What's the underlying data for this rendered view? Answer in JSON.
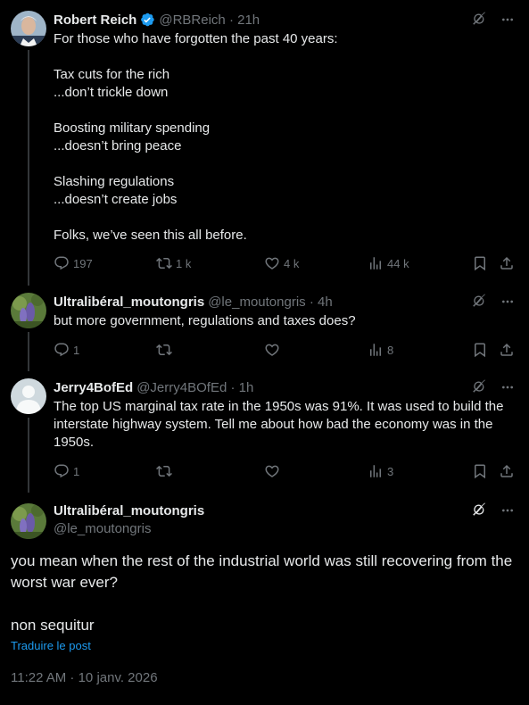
{
  "colors": {
    "accent": "#1d9bf0",
    "muted": "#71767b",
    "text": "#e7e9ea",
    "background": "#000000"
  },
  "tweets": [
    {
      "name": "Robert Reich",
      "handle": "@RBReich",
      "time": "21h",
      "verified": true,
      "text": "For those who have forgotten the past 40 years:\n\nTax cuts for the rich\n...don’t trickle down\n\nBoosting military spending\n...doesn’t bring peace\n\nSlashing regulations\n...doesn’t create jobs\n\nFolks, we’ve seen this all before.",
      "replies": "197",
      "retweets": "1 k",
      "likes": "4 k",
      "views": "44 k"
    },
    {
      "name": "Ultralibéral_moutongris",
      "handle": "@le_moutongris",
      "time": "4h",
      "text": "but more government, regulations and taxes does?",
      "replies": "1",
      "retweets": "",
      "likes": "",
      "views": "8"
    },
    {
      "name": "Jerry4BofEd",
      "handle": "@Jerry4BOfEd",
      "time": "1h",
      "text": "The top US marginal tax rate in the 1950s was 91%. It was used to build the interstate highway system. Tell me about how bad the economy was in the 1950s.",
      "replies": "1",
      "retweets": "",
      "likes": "",
      "views": "3"
    }
  ],
  "main_tweet": {
    "name": "Ultralibéral_moutongris",
    "handle": "@le_moutongris",
    "text": "you mean when the rest of the industrial world was still recovering from the worst war ever?\n\nnon sequitur",
    "translate_label": "Traduire le post",
    "timestamp": "11:22 AM · 10 janv. 2026"
  },
  "icons": [
    "verified-badge-icon",
    "grok-icon",
    "more-icon",
    "reply-icon",
    "retweet-icon",
    "like-icon",
    "views-icon",
    "bookmark-icon",
    "share-icon"
  ]
}
